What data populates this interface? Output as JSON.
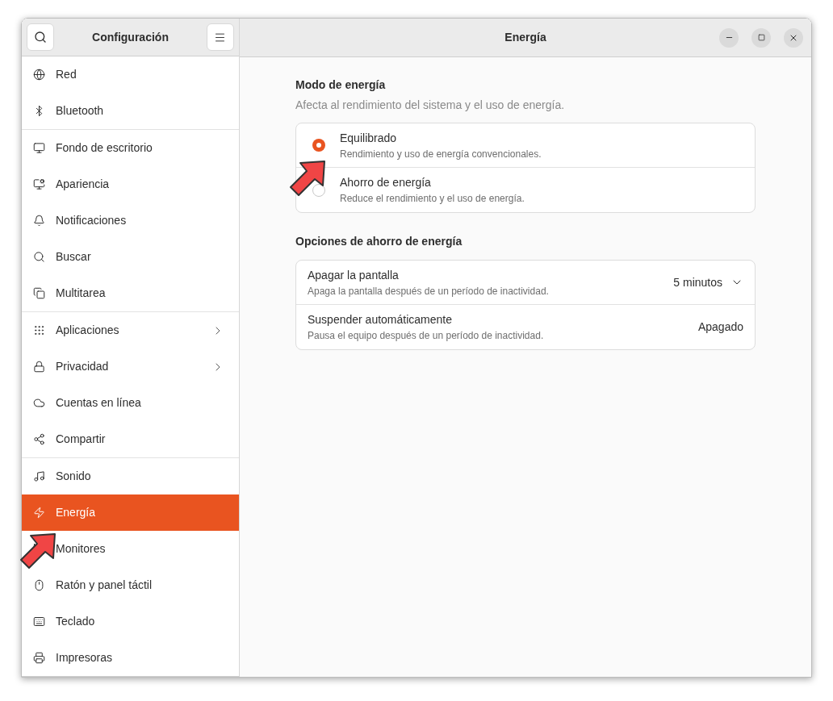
{
  "sidebar": {
    "title": "Configuración",
    "groups": [
      {
        "items": [
          {
            "label": "Red",
            "selected": false,
            "submenu": false
          },
          {
            "label": "Bluetooth",
            "selected": false,
            "submenu": false
          }
        ]
      },
      {
        "items": [
          {
            "label": "Fondo de escritorio",
            "selected": false,
            "submenu": false
          },
          {
            "label": "Apariencia",
            "selected": false,
            "submenu": false
          },
          {
            "label": "Notificaciones",
            "selected": false,
            "submenu": false
          },
          {
            "label": "Buscar",
            "selected": false,
            "submenu": false
          },
          {
            "label": "Multitarea",
            "selected": false,
            "submenu": false
          }
        ]
      },
      {
        "items": [
          {
            "label": "Aplicaciones",
            "selected": false,
            "submenu": true
          },
          {
            "label": "Privacidad",
            "selected": false,
            "submenu": true
          },
          {
            "label": "Cuentas en línea",
            "selected": false,
            "submenu": false
          },
          {
            "label": "Compartir",
            "selected": false,
            "submenu": false
          }
        ]
      },
      {
        "items": [
          {
            "label": "Sonido",
            "selected": false,
            "submenu": false
          },
          {
            "label": "Energía",
            "selected": true,
            "submenu": false
          },
          {
            "label": "Monitores",
            "selected": false,
            "submenu": false
          },
          {
            "label": "Ratón y panel táctil",
            "selected": false,
            "submenu": false
          },
          {
            "label": "Teclado",
            "selected": false,
            "submenu": false
          },
          {
            "label": "Impresoras",
            "selected": false,
            "submenu": false
          }
        ]
      }
    ]
  },
  "window": {
    "title": "Energía"
  },
  "power_mode": {
    "heading": "Modo de energía",
    "description": "Afecta al rendimiento del sistema y el uso de energía.",
    "options": [
      {
        "title": "Equilibrado",
        "subtitle": "Rendimiento y uso de energía convencionales.",
        "selected": true
      },
      {
        "title": "Ahorro de energía",
        "subtitle": "Reduce el rendimiento y el uso de energía.",
        "selected": false
      }
    ]
  },
  "saving_options": {
    "heading": "Opciones de ahorro de energía",
    "rows": [
      {
        "kind": "dropdown",
        "title": "Apagar la pantalla",
        "subtitle": "Apaga la pantalla después de un período de inactividad.",
        "value": "5 minutos"
      },
      {
        "kind": "value",
        "title": "Suspender automáticamente",
        "subtitle": "Pausa el equipo después de un período de inactividad.",
        "value": "Apagado"
      }
    ]
  }
}
